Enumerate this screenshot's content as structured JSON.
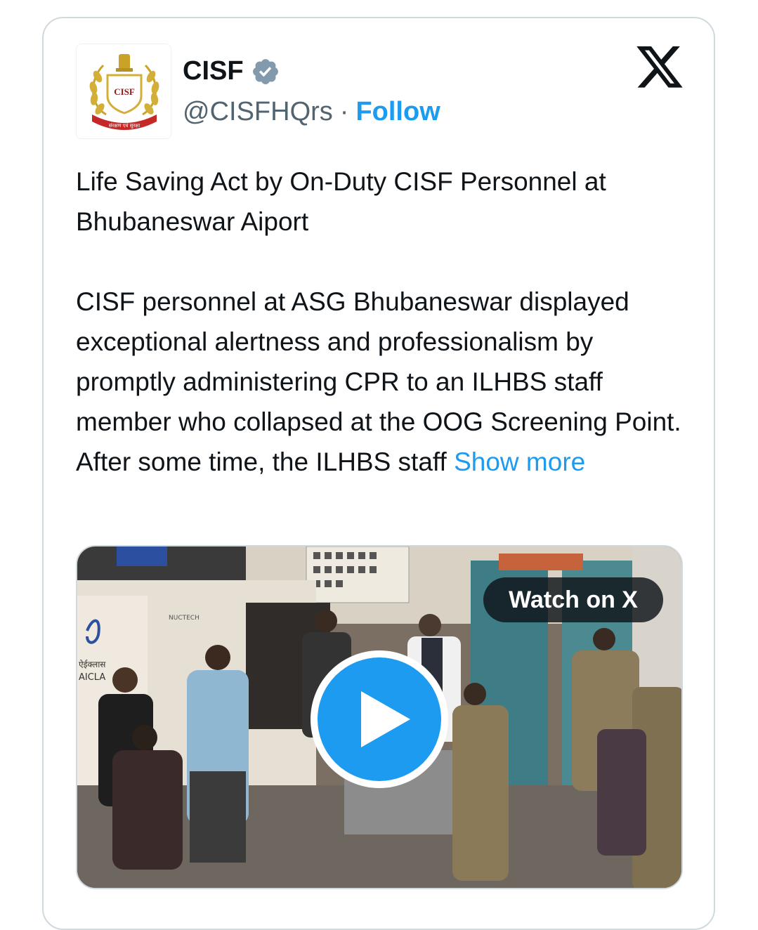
{
  "tweet": {
    "author": {
      "name": "CISF",
      "handle": "@CISFHQrs",
      "separator": "·",
      "follow_label": "Follow",
      "avatar_text": "CISF",
      "avatar_motto": "संरक्षण एवं सुरक्षा"
    },
    "title": "Life Saving Act by On-Duty CISF Personnel at Bhubaneswar Aiport",
    "body": "CISF personnel at ASG Bhubaneswar displayed exceptional alertness and professionalism by promptly administering CPR to an ILHBS staff member who collapsed at the OOG Screening Point. After some time, the ILHBS staff",
    "show_more_label": "Show more",
    "media": {
      "watch_label": "Watch on X",
      "signage_brand": "AICLA",
      "signage_hindi": "ऐईक्लास",
      "scanner_brand": "NUCTECH"
    }
  },
  "colors": {
    "accent": "#1d9bf0",
    "text": "#0f1419",
    "muted": "#536471",
    "border": "#cfd9de"
  },
  "icons": [
    "verified-badge-icon",
    "x-logo-icon",
    "play-icon"
  ]
}
